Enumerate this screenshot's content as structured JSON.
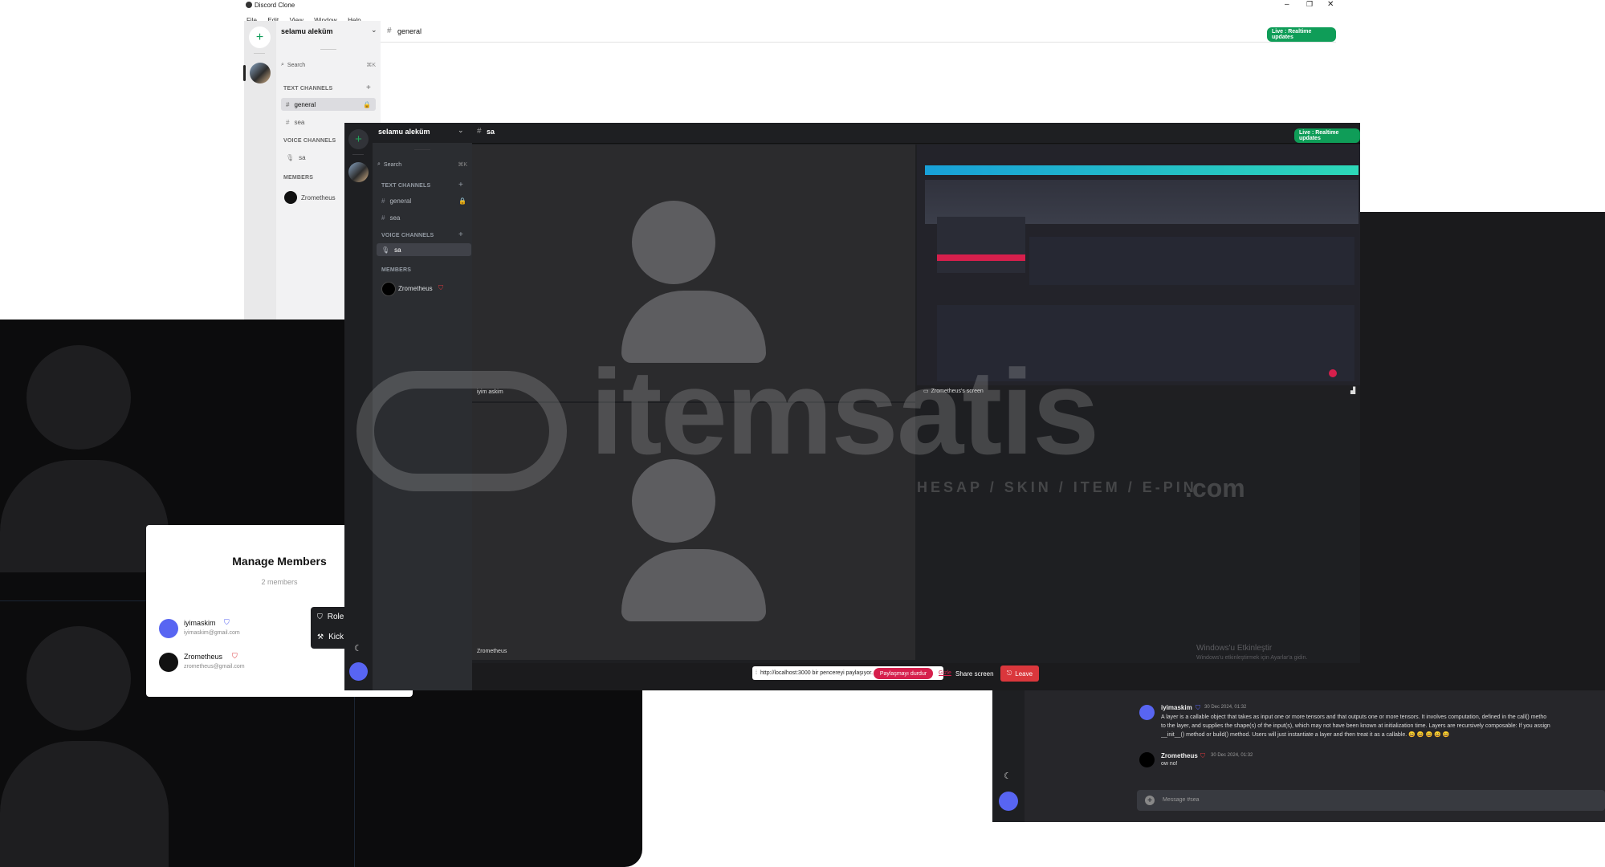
{
  "window": {
    "title": "Discord Clone",
    "menu": [
      "File",
      "Edit",
      "View",
      "Window",
      "Help"
    ]
  },
  "light_app": {
    "server_name": "selamu aleküm",
    "search_label": "Search",
    "search_shortcut": "⌘K",
    "text_channels_label": "TEXT CHANNELS",
    "text_channels": [
      "general",
      "sea"
    ],
    "voice_channels_label": "VOICE CHANNELS",
    "voice_channels": [
      "sa"
    ],
    "members_label": "MEMBERS",
    "members": [
      "Zrometheus"
    ],
    "header_channel": "general",
    "live_badge": "Live : Realtime updates"
  },
  "manage_members": {
    "title": "Manage Members",
    "count": "2 members",
    "members": [
      {
        "name": "iyimaskim",
        "email": "iyimaskim@gmail.com"
      },
      {
        "name": "Zrometheus",
        "email": "zrometheus@gmail.com"
      }
    ],
    "menu_items": [
      "Role",
      "Kick"
    ]
  },
  "main_app": {
    "server_name": "selamu aleküm",
    "search_label": "Search",
    "search_shortcut": "⌘K",
    "text_channels_label": "TEXT CHANNELS",
    "text_channels": [
      "general",
      "sea"
    ],
    "voice_channels_label": "VOICE CHANNELS",
    "voice_channels": [
      "sa"
    ],
    "members_label": "MEMBERS",
    "members": [
      "Zrometheus"
    ],
    "header_channel": "sa",
    "live_badge": "Live : Realtime updates",
    "tiles": {
      "tile_a_label": "iyim askim",
      "tile_b_label": "Zrometheus",
      "tile_c_label": "Zrometheus's screen"
    },
    "share_bar": {
      "text": "http://localhost:3000 bir pencereyi paylaşıyor.",
      "stop_label": "Paylaşmayı durdur",
      "hide_label": "Gizle",
      "share_label": "Share screen",
      "leave_label": "Leave"
    },
    "windows_activation": {
      "title": "Windows'u Etkinleştir",
      "subtitle": "Windows'u etkinleştirmek için Ayarlar'a gidin."
    }
  },
  "chat": {
    "messages": [
      {
        "author": "iyimaskim",
        "time": "30 Dec 2024, 01:32",
        "text_line1": "A layer is a callable object that takes as input one or more tensors and that outputs one or more tensors. It involves computation, defined in the call() metho",
        "text_line2": "to the layer, and supplies the shape(s) of the input(s), which may not have been known at initialization time. Layers are recursively composable: If you assign",
        "text_line3": "__init__() method or build() method. Users will just instantiate a layer and then treat it as a callable. 😄 😄 😄 😄 😄"
      },
      {
        "author": "Zrometheus",
        "time": "30 Dec 2024, 01:32",
        "text_line1": "ow no!"
      }
    ],
    "input_placeholder": "Message #sea"
  },
  "watermark": {
    "brand": "itemsatis",
    "tagline": "HESAP / SKIN / ITEM / E-PIN",
    "suffix": ".com"
  },
  "colors": {
    "accent_green": "#0f9d58",
    "leave_red": "#da373c",
    "avatar_purple": "#5865f2"
  }
}
